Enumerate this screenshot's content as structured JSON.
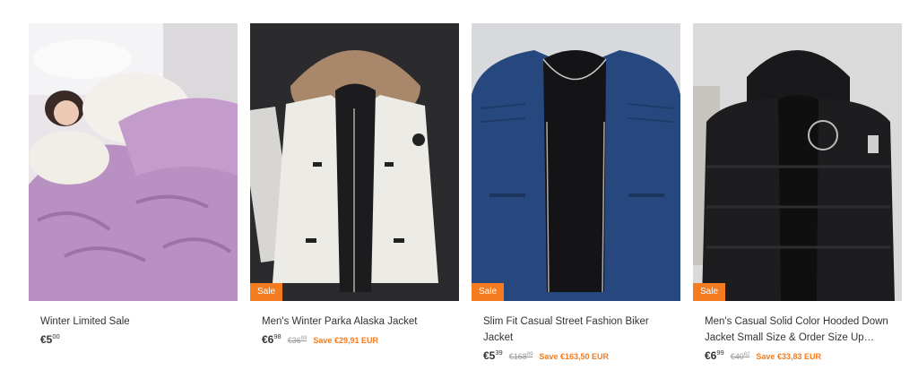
{
  "products": [
    {
      "image": "purple-fleece-blanket-photo",
      "sale_badge": "",
      "title": "Winter Limited Sale",
      "price_main": "€5",
      "price_cents": "00",
      "old_main": "",
      "old_cents": "",
      "save": ""
    },
    {
      "image": "white-parka-fur-hood-photo",
      "sale_badge": "Sale",
      "title": "Men's Winter Parka Alaska Jacket",
      "price_main": "€6",
      "price_cents": "98",
      "old_main": "€36",
      "old_cents": "89",
      "save": "Save €29,91 EUR"
    },
    {
      "image": "blue-leather-biker-jacket-photo",
      "sale_badge": "Sale",
      "title": "Slim Fit Casual Street Fashion Biker Jacket",
      "price_main": "€5",
      "price_cents": "39",
      "old_main": "€168",
      "old_cents": "89",
      "save": "Save €163,50 EUR"
    },
    {
      "image": "black-hooded-down-jacket-photo",
      "sale_badge": "Sale",
      "title": "Men's Casual Solid Color Hooded Down Jacket Small Size & Order Size Up Jacket...",
      "price_main": "€6",
      "price_cents": "99",
      "old_main": "€40",
      "old_cents": "82",
      "save": "Save €33,83 EUR"
    }
  ],
  "colors": {
    "accent": "#f47b20",
    "text": "#333333",
    "muted": "#999999"
  }
}
